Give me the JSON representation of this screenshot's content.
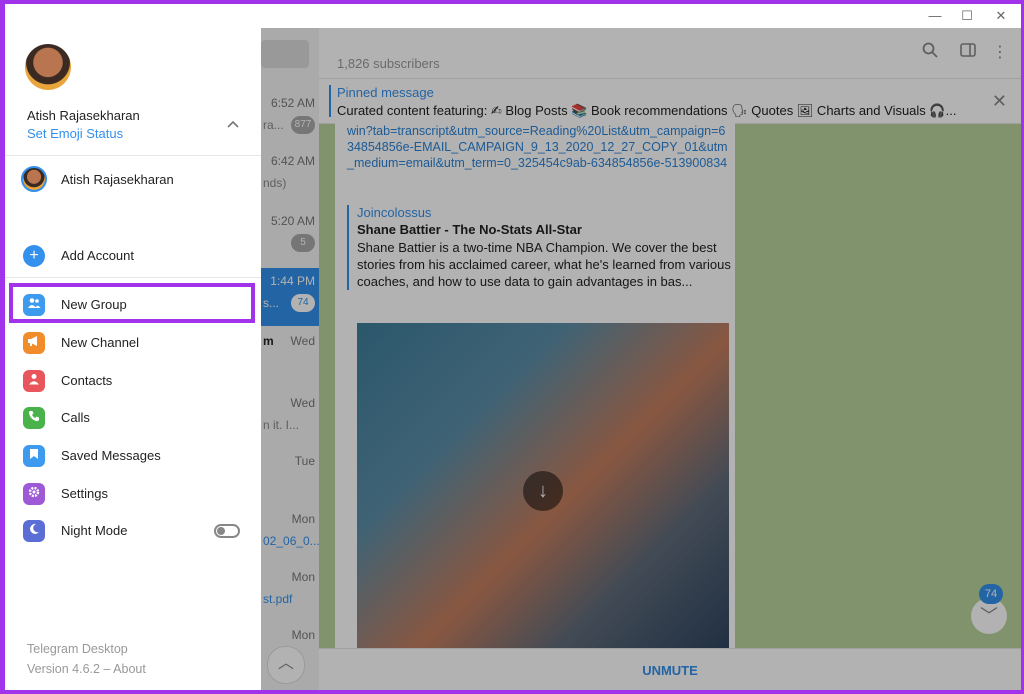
{
  "window": {
    "minimize_glyph": "—",
    "maximize_glyph": "☐",
    "close_glyph": "✕"
  },
  "chat_list": {
    "items": [
      {
        "time": "6:52 AM",
        "sub": "ra...",
        "badge": "877"
      },
      {
        "time": "6:42 AM",
        "sub": "nds)",
        "badge": ""
      },
      {
        "time": "5:20 AM",
        "sub": "",
        "badge": "5"
      },
      {
        "time": "1:44 PM",
        "sub": "s...",
        "badge": "74"
      },
      {
        "time": "Wed",
        "sub": "m",
        "badge": ""
      },
      {
        "time": "Wed",
        "sub": "n it. I...",
        "badge": ""
      },
      {
        "time": "Tue",
        "sub": "",
        "badge": ""
      },
      {
        "time": "Mon",
        "sub": "02_06_0...",
        "badge": ""
      },
      {
        "time": "Mon",
        "sub": "st.pdf",
        "badge": ""
      },
      {
        "time": "Mon",
        "sub": "",
        "badge": ""
      }
    ]
  },
  "chat": {
    "subscribers": "1,826 subscribers",
    "pinned": {
      "title": "Pinned message",
      "text": "Curated content featuring: ✍ Blog Posts 📚 Book recommendations 🗣 Quotes 🖼 Charts and Visuals 🎧..."
    },
    "message": {
      "link_text": "win?tab=transcript&utm_source=Reading%20List&utm_campaign=634854856e-EMAIL_CAMPAIGN_9_13_2020_12_27_COPY_01&utm_medium=email&utm_term=0_325454c9ab-634854856e-513900834",
      "preview_source": "Joincolossus",
      "preview_title": "Shane Battier - The No-Stats All-Star",
      "preview_text": "Shane Battier is a two-time NBA Champion. We cover the best stories from his acclaimed career, what he's learned from various coaches, and how to use data to gain advantages in bas..."
    },
    "unread_badge": "74",
    "unmute_label": "UNMUTE"
  },
  "menu": {
    "user_name": "Atish Rajasekharan",
    "emoji_status": "Set Emoji Status",
    "account_name": "Atish Rajasekharan",
    "add_account": "Add Account",
    "items": [
      {
        "label": "New Group",
        "icon": "group-icon",
        "color": "#3d9bef"
      },
      {
        "label": "New Channel",
        "icon": "megaphone-icon",
        "color": "#f28c2b"
      },
      {
        "label": "Contacts",
        "icon": "person-icon",
        "color": "#e8555a"
      },
      {
        "label": "Calls",
        "icon": "phone-icon",
        "color": "#49b24b"
      },
      {
        "label": "Saved Messages",
        "icon": "bookmark-icon",
        "color": "#3d9bef"
      },
      {
        "label": "Settings",
        "icon": "gear-icon",
        "color": "#9e5ad6"
      },
      {
        "label": "Night Mode",
        "icon": "moon-icon",
        "color": "#5a6ed6"
      }
    ],
    "app_name": "Telegram Desktop",
    "app_version": "Version 4.6.2 – About"
  },
  "accent_color": "#3390ec",
  "highlight_color": "#a133ea"
}
